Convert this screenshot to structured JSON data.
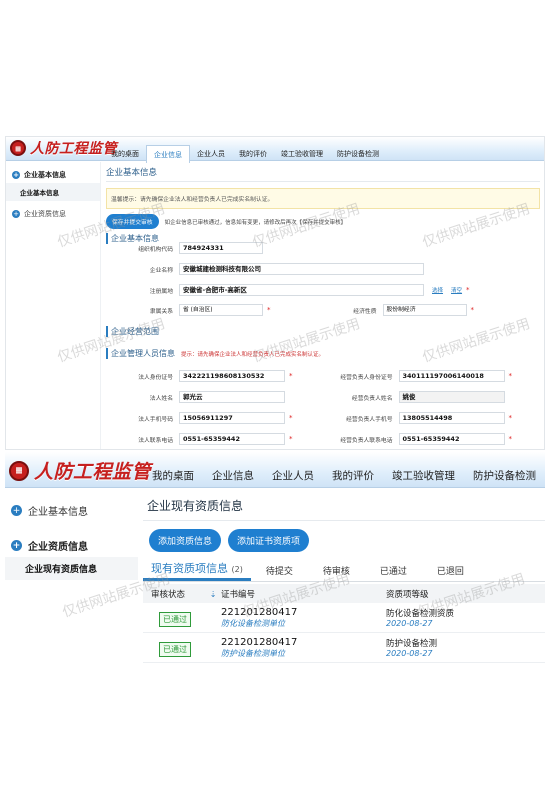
{
  "panel1": {
    "logo": "人防工程监管",
    "nav": [
      "我的桌面",
      "企业信息",
      "企业人员",
      "我的评价",
      "竣工验收管理",
      "防护设备检测"
    ],
    "sidebar": {
      "section1": "企业基本信息",
      "section1_sub": "企业基本信息",
      "section2": "企业资质信息"
    },
    "page_title": "企业基本信息",
    "notice": "温馨提示：请先确保企业法人和经营负责人已完成实名制认证。",
    "save_button": "保存并提交审核",
    "save_tip": "如企业信息已审核通过，信息如有变更，请修改后再次【保存并提交审核】",
    "section_basic": "企业基本信息",
    "org_code_label": "组织机构代码",
    "org_code": "784924331",
    "company_name_label": "企业名称",
    "company_name": "安徽城建检测科技有限公司",
    "address_label": "注册属地",
    "address": "安徽省-合肥市-高新区",
    "address_select": "选择",
    "address_clear": "清空",
    "affil_label": "隶属关系",
    "affil_value": "省 (自治区)",
    "econ_label": "经济性质",
    "econ_value": "股份制经济",
    "section_business": "企业经营范围",
    "section_mgmt": "企业管理人员信息",
    "mgmt_tip": "提示：请先确保企业法人和经营负责人已完成实名制认证。",
    "legal_id_label": "法人身份证号",
    "legal_id": "342221198608130532",
    "mgr_id_label": "经营负责人身份证号",
    "mgr_id": "340111197006140018",
    "legal_name_label": "法人姓名",
    "legal_name": "郭光云",
    "mgr_name_label": "经营负责人姓名",
    "mgr_name": "姚俊",
    "legal_phone_label": "法人手机号码",
    "legal_phone": "15056911297",
    "mgr_phone_label": "经营负责人手机号",
    "mgr_phone": "13805514498",
    "legal_tel_label": "法人联系电话",
    "legal_tel": "0551-65359442",
    "mgr_tel_label": "经营负责人联系电话",
    "mgr_tel": "0551-65359442"
  },
  "panel2": {
    "logo": "人防工程监管",
    "nav": [
      "我的桌面",
      "企业信息",
      "企业人员",
      "我的评价",
      "竣工验收管理",
      "防护设备检测"
    ],
    "sidebar": {
      "section1": "企业基本信息",
      "section2": "企业资质信息",
      "section2_sub": "企业现有资质信息"
    },
    "page_title": "企业现有资质信息",
    "btn_add_qual": "添加资质信息",
    "btn_add_cert": "添加证书资质项",
    "tabs": {
      "active": "现有资质项信息",
      "active_count": "(2)",
      "t2": "待提交",
      "t3": "待审核",
      "t4": "已通过",
      "t5": "已退回"
    },
    "table": {
      "col_status": "审核状态",
      "col_cert": "证书编号",
      "col_level": "资质项等级",
      "rows": [
        {
          "status": "已通过",
          "cert_no": "221201280417",
          "unit": "防化设备检测单位",
          "level": "防化设备检测资质",
          "date": "2020-08-27"
        },
        {
          "status": "已通过",
          "cert_no": "221201280417",
          "unit": "防护设备检测单位",
          "level": "防护设备检测",
          "date": "2020-08-27"
        }
      ]
    }
  },
  "watermark": "仅供网站展示使用",
  "colors": {
    "brand_red": "#c6201f",
    "accent_blue": "#2a7dc0",
    "approved_green": "#2f9a3a"
  },
  "icons": {
    "logo": "logo-badge-icon",
    "sidebar_section": "plus-circle-icon",
    "sort": "sort-icon"
  }
}
